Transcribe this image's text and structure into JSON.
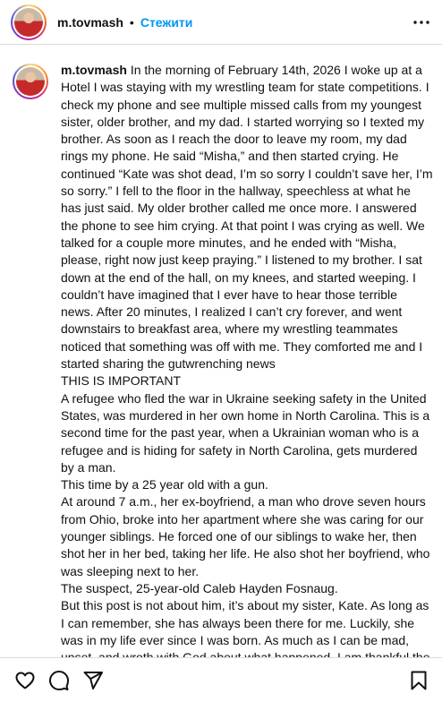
{
  "header": {
    "username": "m.tovmash",
    "separator": "•",
    "follow_label": "Стежити",
    "avatar_icon": "profile-photo",
    "more_icon": "more-horizontal-icon"
  },
  "post": {
    "username": "m.tovmash",
    "caption": "In the morning of February 14th, 2026 I woke up at a Hotel I was staying with my wrestling team for state competitions. I check my phone and see multiple missed calls from my youngest sister, older brother, and my dad. I started worrying so I texted my brother. As soon as I reach the door to leave my room, my dad rings my phone. He said “Misha,” and then started crying. He continued “Kate was shot dead, I’m so sorry I couldn’t save her, I’m so sorry.” I fell to the floor in the hallway, speechless at what he has just said. My older brother called me once more. I answered the phone to see him crying. At that point I was crying as well. We talked for a couple more minutes, and he ended with “Misha, please, right now just keep praying.” I listened to my brother. I sat down at the end of the hall, on my knees, and started weeping. I couldn’t have imagined that I ever have to hear those terrible news. After 20 minutes, I realized I can’t cry forever, and went downstairs to breakfast area, where my wrestling teammates noticed that something was off with me. They comforted me and I started sharing the gutwrenching news\nTHIS IS IMPORTANT\nA refugee who fled the war in Ukraine seeking safety in the United States, was murdered in her own home in North Carolina. This is a second time for the past year, when a Ukrainian woman who is a refugee and is hiding for safety in North Carolina, gets murdered by a man.\nThis time by a 25 year old with a gun.\nAt around 7 a.m., her ex-boyfriend, a man who drove seven hours from Ohio, broke into her apartment where she was caring for our younger siblings. He forced one of our siblings to wake her, then shot her in her bed, taking her life. He also shot her boyfriend, who was sleeping next to her.\nThe suspect, 25-year-old Caleb Hayden Fosnaug.\nBut this post is not about him, it’s about my sister, Kate. As long as I can remember, she has always been there for me. Luckily, she was in my life ever since I was born. As much as I can be mad, upset, and wroth with God about what happened, I am thankful the murderer didn’t touch any of my younger siblings who were"
  },
  "actions": {
    "icons": [
      "heart-icon",
      "comment-icon",
      "share-icon",
      "bookmark-icon"
    ]
  }
}
